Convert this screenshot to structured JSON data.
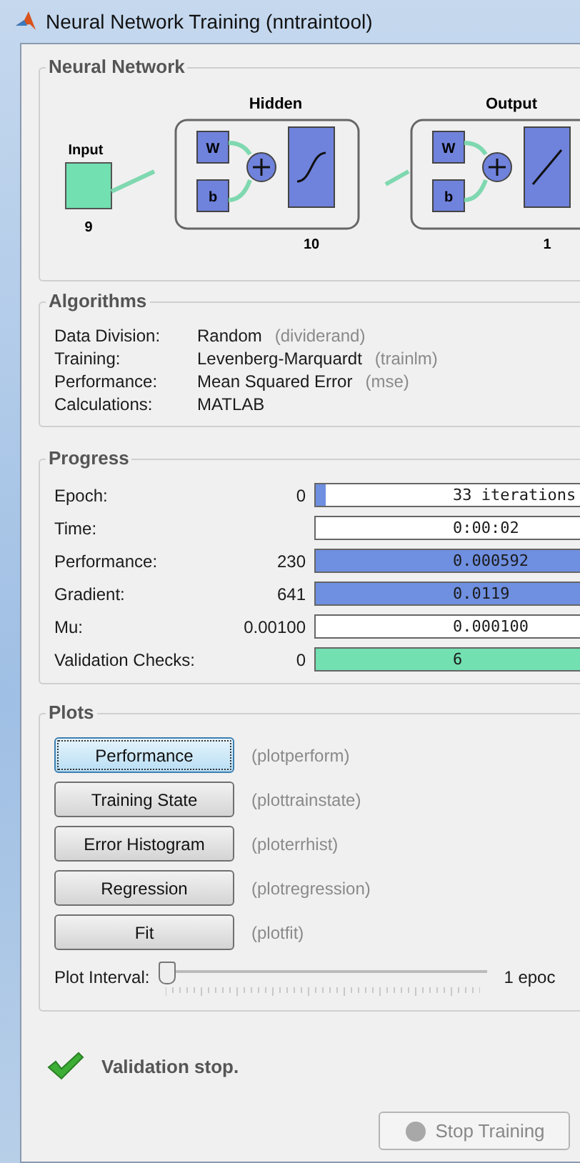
{
  "window": {
    "title": "Neural Network Training (nntraintool)"
  },
  "neural_network": {
    "title": "Neural Network",
    "input": {
      "label": "Input",
      "size": "9"
    },
    "layers": [
      {
        "name": "Hidden",
        "size": "10",
        "weight": "W",
        "bias": "b",
        "kind": "sigmoid"
      },
      {
        "name": "Output",
        "size": "1",
        "weight": "W",
        "bias": "b",
        "kind": "linear"
      }
    ]
  },
  "algorithms": {
    "title": "Algorithms",
    "rows": [
      {
        "label": "Data Division:",
        "value": "Random",
        "function": "(dividerand)"
      },
      {
        "label": "Training:",
        "value": "Levenberg-Marquardt",
        "function": "(trainlm)"
      },
      {
        "label": "Performance:",
        "value": "Mean Squared Error",
        "function": "(mse)"
      },
      {
        "label": "Calculations:",
        "value": "MATLAB"
      }
    ]
  },
  "progress": {
    "title": "Progress",
    "rows": [
      {
        "label": "Epoch:",
        "start": "0",
        "reading": "33 iterations",
        "level": 0.03,
        "color": "#6f8fe0"
      },
      {
        "label": "Time:",
        "reading": "0:00:02"
      },
      {
        "label": "Performance:",
        "start": "230",
        "reading": "0.000592",
        "level": 1,
        "color": "#6f8fe0"
      },
      {
        "label": "Gradient:",
        "start": "641",
        "reading": "0.0119",
        "level": 1,
        "color": "#6f8fe0"
      },
      {
        "label": "Mu:",
        "start": "0.00100",
        "reading": "0.000100"
      },
      {
        "label": "Validation Checks:",
        "start": "0",
        "reading": "6",
        "level": 1,
        "color": "#72e0b0"
      }
    ]
  },
  "plots": {
    "title": "Plots",
    "buttons": [
      {
        "label": "Performance",
        "function": "(plotperform)",
        "selected": true
      },
      {
        "label": "Training State",
        "function": "(plottrainstate)",
        "selected": false
      },
      {
        "label": "Error Histogram",
        "function": "(ploterrhist)",
        "selected": false
      },
      {
        "label": "Regression",
        "function": "(plotregression)",
        "selected": false
      },
      {
        "label": "Fit",
        "function": "(plotfit)",
        "selected": false
      }
    ],
    "interval": {
      "label": "Plot Interval:",
      "level": 0,
      "reading": "1 epoc"
    }
  },
  "status": {
    "message": "Validation stop."
  },
  "stop_button": {
    "label": "Stop Training",
    "disabled": true
  }
}
